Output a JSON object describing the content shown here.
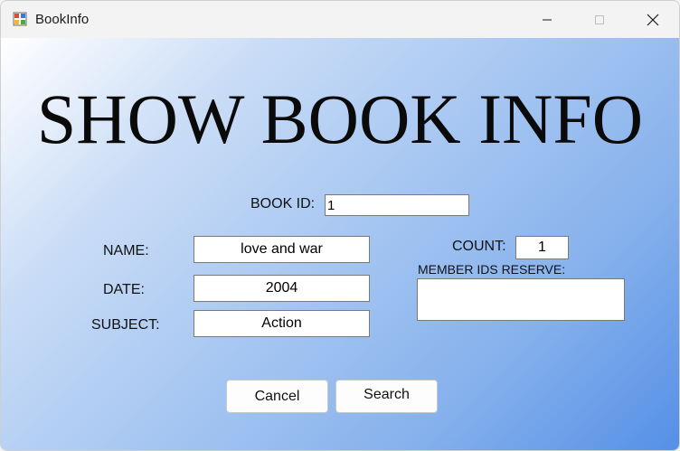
{
  "window": {
    "title": "BookInfo",
    "icon": "winforms-app-icon",
    "controls": {
      "minimize": "minimize-icon",
      "maximize": "maximize-icon",
      "close": "close-icon"
    }
  },
  "form": {
    "heading": "SHOW BOOK INFO",
    "book_id_label": "BOOK ID:",
    "book_id_value": "1",
    "name_label": "NAME:",
    "name_value": "love and war",
    "date_label": "DATE:",
    "date_value": "2004",
    "subject_label": "SUBJECT:",
    "subject_value": "Action",
    "count_label": "COUNT:",
    "count_value": "1",
    "member_ids_label": "MEMBER IDS RESERVE:",
    "member_ids_value": ""
  },
  "buttons": {
    "cancel": "Cancel",
    "search": "Search"
  },
  "colors": {
    "gradient_start": "#ffffff",
    "gradient_end": "#5590e6",
    "titlebar": "#f3f3f3"
  }
}
